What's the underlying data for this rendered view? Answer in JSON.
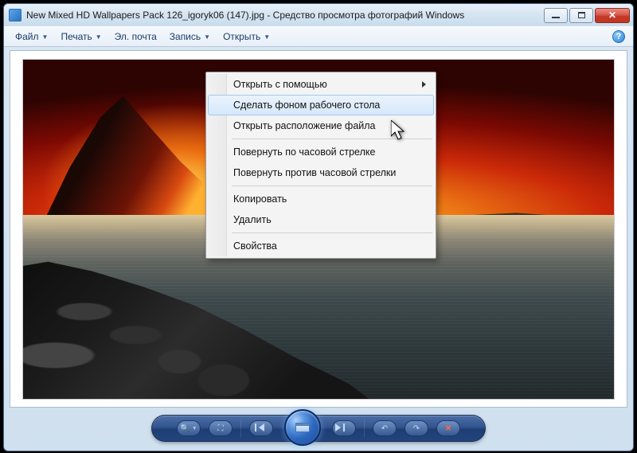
{
  "window": {
    "title": "New Mixed HD Wallpapers Pack 126_igoryk06 (147).jpg - Средство просмотра фотографий Windows"
  },
  "menubar": {
    "items": [
      {
        "label": "Файл"
      },
      {
        "label": "Печать"
      },
      {
        "label": "Эл. почта"
      },
      {
        "label": "Запись"
      },
      {
        "label": "Открыть"
      }
    ],
    "help_tooltip": "?"
  },
  "context_menu": {
    "items": [
      {
        "label": "Открыть с помощью",
        "has_submenu": true
      },
      {
        "label": "Сделать фоном рабочего стола",
        "highlighted": true
      },
      {
        "label": "Открыть расположение файла"
      },
      {
        "sep": true
      },
      {
        "label": "Повернуть по часовой стрелке"
      },
      {
        "label": "Повернуть против часовой стрелки"
      },
      {
        "sep": true
      },
      {
        "label": "Копировать"
      },
      {
        "label": "Удалить"
      },
      {
        "sep": true
      },
      {
        "label": "Свойства"
      }
    ]
  },
  "toolbar": {
    "zoom": "🔍",
    "fit": "⛶",
    "prev": "prev",
    "play": "slideshow",
    "next": "next",
    "rotate_ccw": "↶",
    "rotate_cw": "↷",
    "delete": "✕"
  }
}
